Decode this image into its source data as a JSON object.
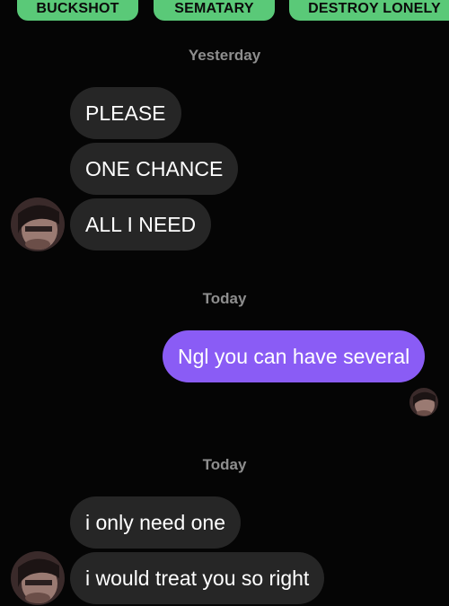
{
  "tags": {
    "first": "BUCKSHOT",
    "second": "SEMATARY",
    "third": "DESTROY LONELY"
  },
  "dividers": {
    "yesterday": "Yesterday",
    "today_1": "Today",
    "today_2": "Today"
  },
  "messages": [
    {
      "sender": "them",
      "text": "PLEASE"
    },
    {
      "sender": "them",
      "text": "ONE CHANCE"
    },
    {
      "sender": "them",
      "text": "ALL I NEED"
    },
    {
      "sender": "me",
      "text": "Ngl you can have several"
    },
    {
      "sender": "them",
      "text": "i only need one"
    },
    {
      "sender": "them",
      "text": "i would treat you so right"
    }
  ],
  "colors": {
    "background": "#050505",
    "incoming_bubble": "#262626",
    "outgoing_bubble": "#8a5cf5",
    "tag": "#5ac978",
    "timestamp": "#8e8e8e"
  }
}
